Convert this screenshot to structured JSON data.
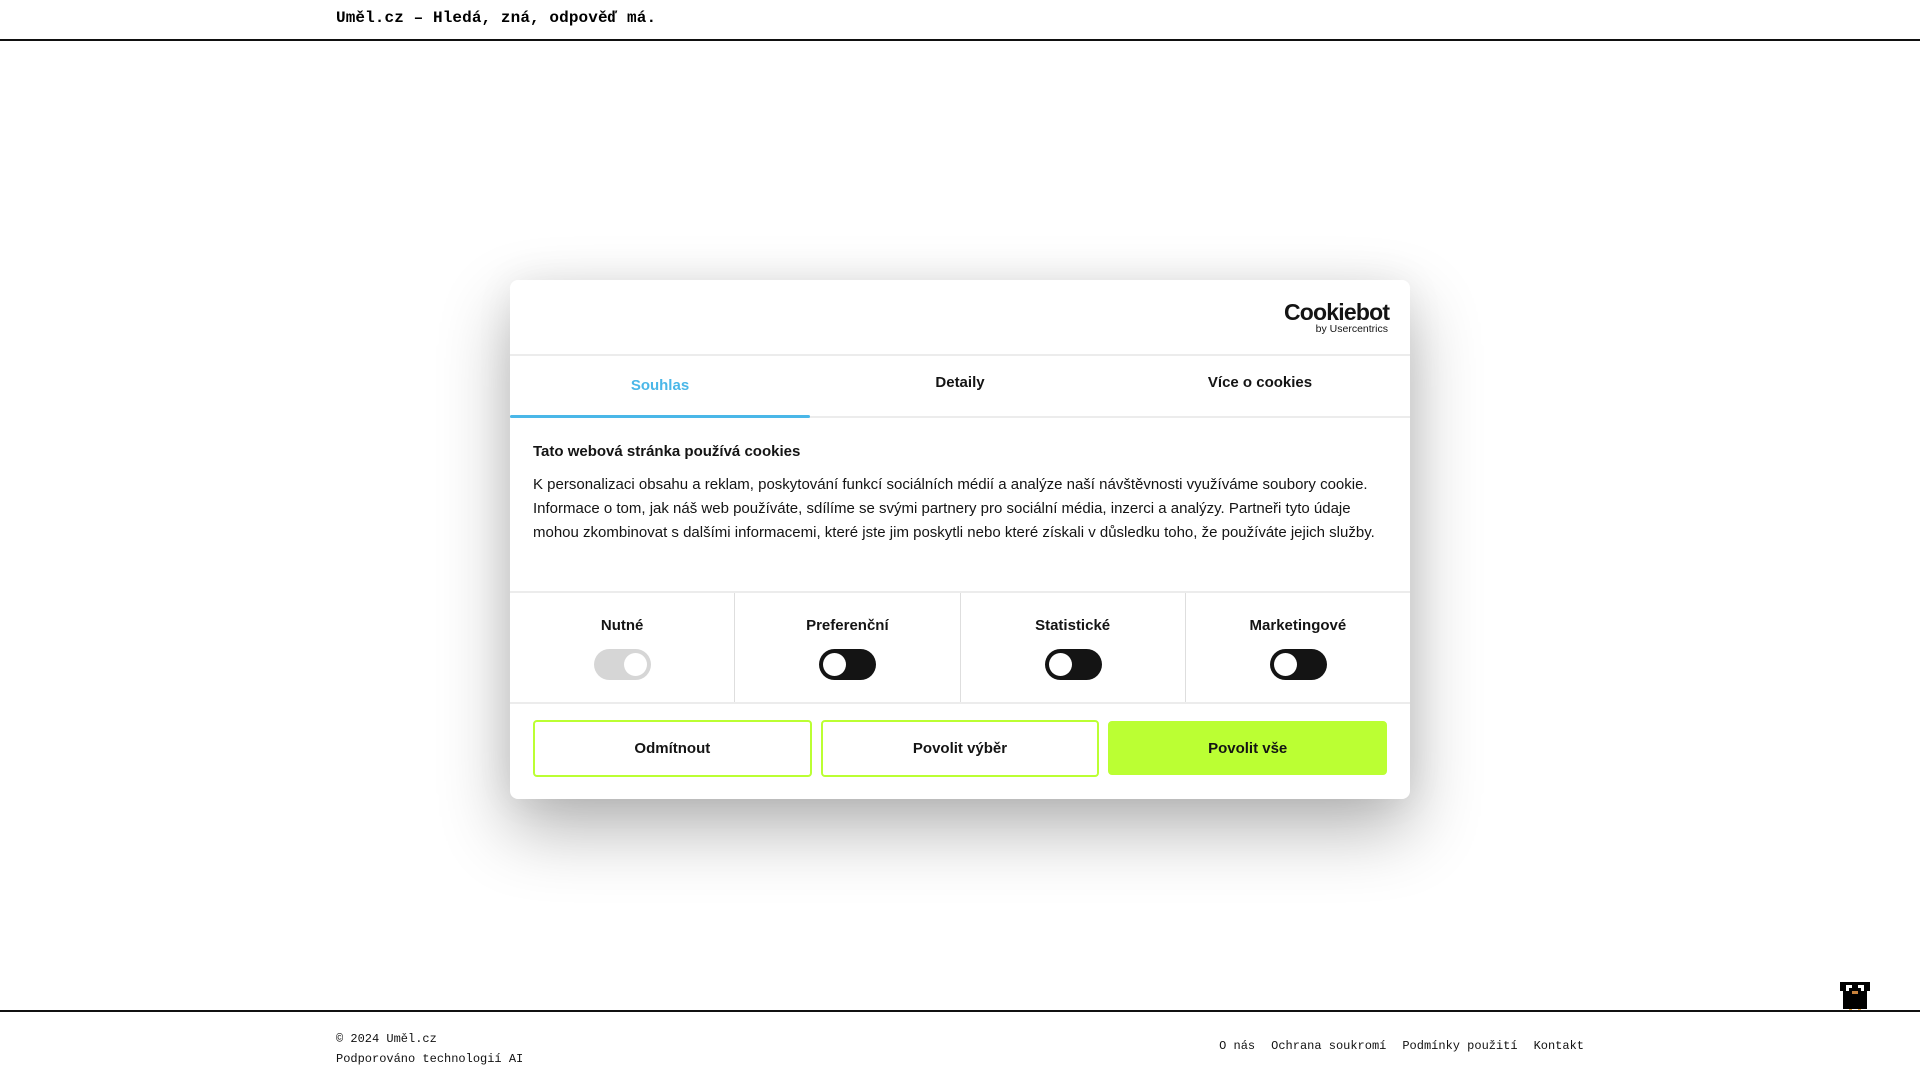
{
  "header": {
    "site_title": "Uměl.cz – Hledá, zná, odpověď má."
  },
  "dialog": {
    "logo": {
      "name": "Cookiebot",
      "byline": "by Usercentrics"
    },
    "tabs": [
      {
        "label": "Souhlas",
        "active": true
      },
      {
        "label": "Detaily",
        "active": false
      },
      {
        "label": "Více o cookies",
        "active": false
      }
    ],
    "title": "Tato webová stránka používá cookies",
    "text": "K personalizaci obsahu a reklam, poskytování funkcí sociálních médií a analýze naší návštěvnosti využíváme soubory cookie. Informace o tom, jak náš web používáte, sdílíme se svými partnery pro sociální média, inzerci a analýzy. Partneři tyto údaje mohou zkombinovat s dalšími informacemi, které jste jim poskytli nebo které získali v důsledku toho, že používáte jejich služby.",
    "categories": [
      {
        "label": "Nutné",
        "checked": true,
        "disabled": true
      },
      {
        "label": "Preferenční",
        "checked": false,
        "disabled": false
      },
      {
        "label": "Statistické",
        "checked": false,
        "disabled": false
      },
      {
        "label": "Marketingové",
        "checked": false,
        "disabled": false
      }
    ],
    "buttons": {
      "decline": "Odmítnout",
      "allow_selection": "Povolit výběr",
      "allow_all": "Povolit vše"
    },
    "colors": {
      "accent": "#4ab7e8",
      "button": "#bbff33"
    }
  },
  "mascot": {
    "icon": "penguin-mascot-icon"
  },
  "footer": {
    "copyright": "© 2024 Uměl.cz",
    "powered_by": "Podporováno technologií AI",
    "links": [
      "O nás",
      "Ochrana soukromí",
      "Podmínky použití",
      "Kontakt"
    ]
  }
}
